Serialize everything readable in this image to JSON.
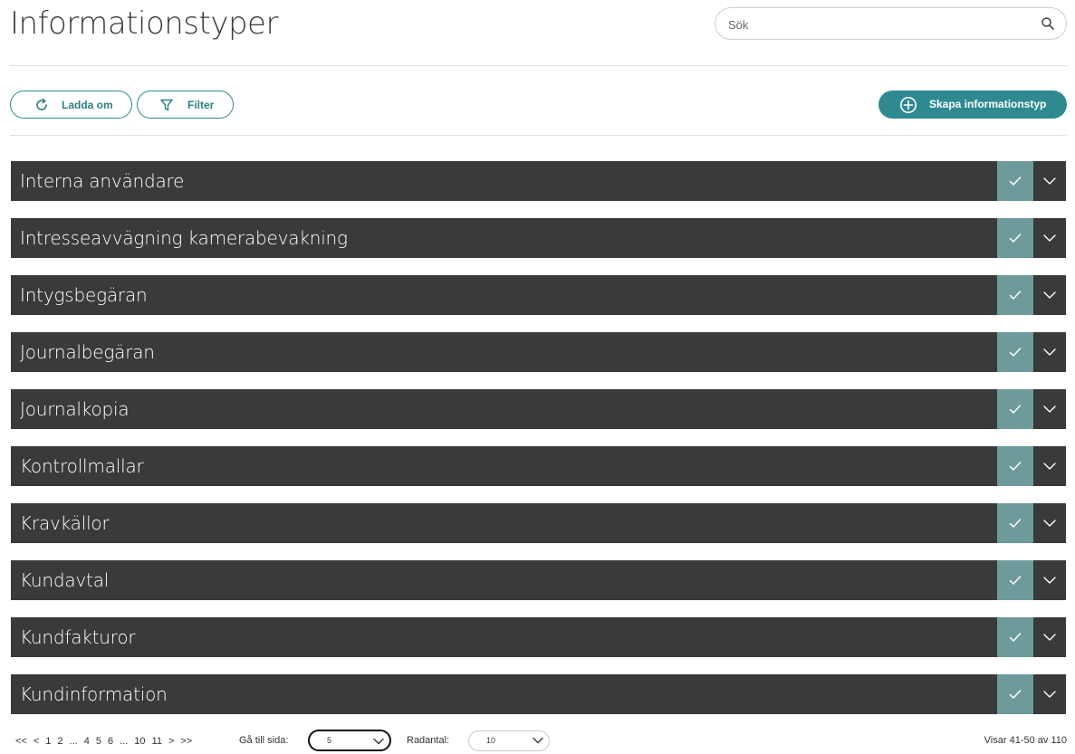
{
  "header": {
    "title": "Informationstyper",
    "search_placeholder": "Sök"
  },
  "toolbar": {
    "reload_label": "Ladda om",
    "filter_label": "Filter",
    "create_label": "Skapa informationstyp"
  },
  "items": [
    {
      "title": "Interna användare"
    },
    {
      "title": "Intresseavvägning kamerabevakning"
    },
    {
      "title": "Intygsbegäran"
    },
    {
      "title": "Journalbegäran"
    },
    {
      "title": "Journalkopia"
    },
    {
      "title": "Kontrollmallar"
    },
    {
      "title": "Kravkällor"
    },
    {
      "title": "Kundavtal"
    },
    {
      "title": "Kundfakturor"
    },
    {
      "title": "Kundinformation"
    }
  ],
  "pagination": {
    "first": "<<",
    "prev": "<",
    "p1": "1",
    "p2": "2",
    "ellipsis1": "...",
    "p4": "4",
    "p5": "5",
    "p6": "6",
    "ellipsis2": "...",
    "p10": "10",
    "p11": "11",
    "next": ">",
    "last": ">>",
    "goto_label": "Gå till sida:",
    "goto_value": "5",
    "rows_label": "Radantal:",
    "rows_value": "10",
    "range_text": "Visar 41-50 av 110"
  },
  "colors": {
    "accent": "#2e8a90",
    "row_bg": "#3a3a3a",
    "check_bg": "#6e9a9c"
  },
  "icons": {
    "search": "search-icon",
    "reload": "reload-icon",
    "filter": "filter-icon",
    "add": "plus-circle-icon",
    "check": "check-icon",
    "expand": "chevron-down-icon"
  }
}
